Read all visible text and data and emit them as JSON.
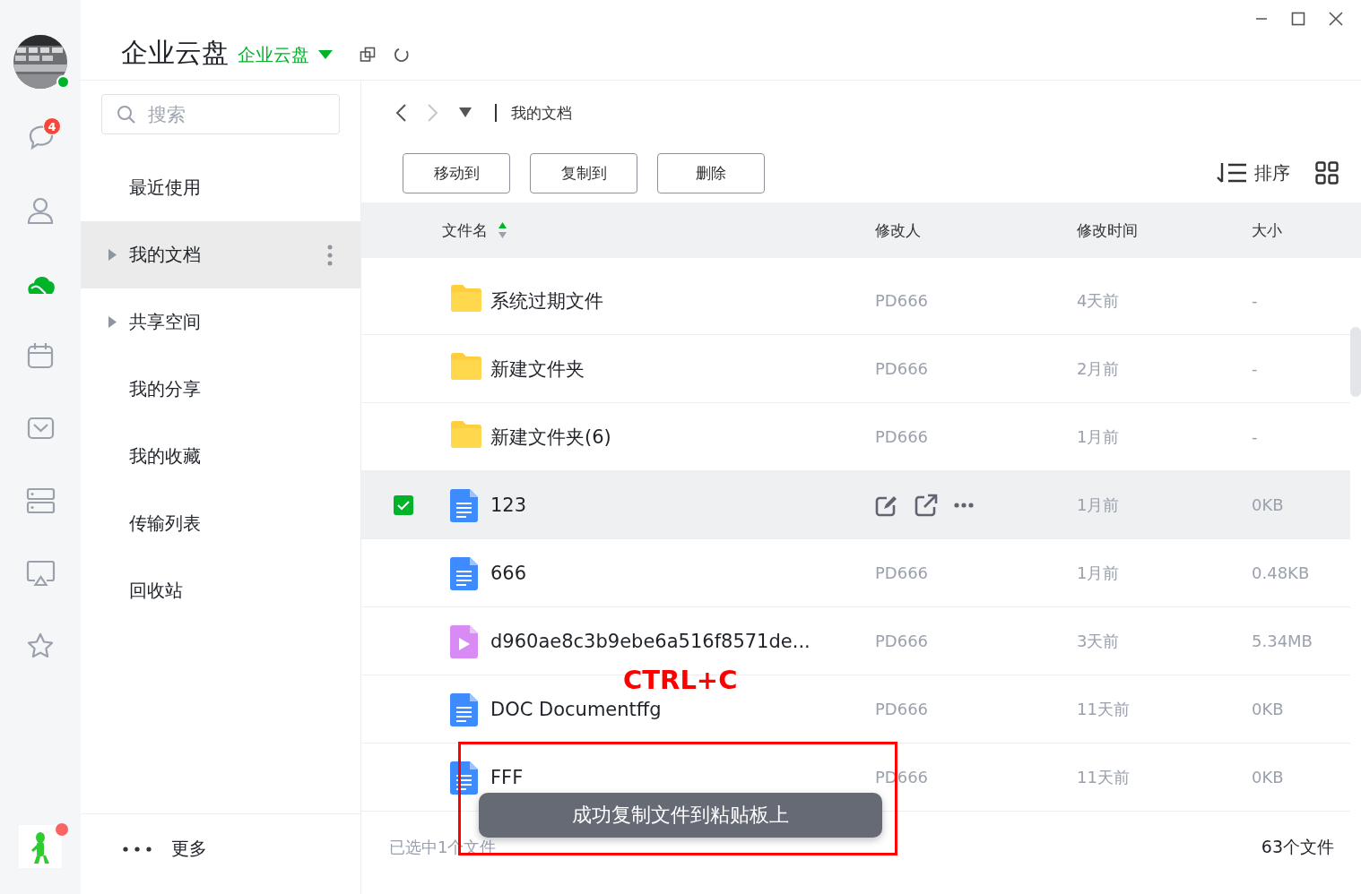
{
  "window": {
    "title": "企业云盘",
    "subtitle": "企业云盘"
  },
  "rail": {
    "avatar": {
      "kind": "picture",
      "online": true
    },
    "items": [
      {
        "kind": "chat",
        "selected": false,
        "badge": "4"
      },
      {
        "kind": "contacts",
        "selected": false
      },
      {
        "kind": "cloud",
        "selected": true
      },
      {
        "kind": "calendar",
        "selected": false
      },
      {
        "kind": "mail",
        "selected": false
      },
      {
        "kind": "storage",
        "selected": false
      },
      {
        "kind": "screen",
        "selected": false
      },
      {
        "kind": "star",
        "selected": false
      }
    ],
    "app_icon": {
      "kind": "picture",
      "unread": true
    }
  },
  "sidebar": {
    "search": {
      "placeholder": "搜索"
    },
    "items": [
      {
        "label": "最近使用",
        "kind": "page",
        "selected": false
      },
      {
        "label": "我的文档",
        "kind": "group",
        "selected": true
      },
      {
        "label": "共享空间",
        "kind": "group",
        "selected": false
      },
      {
        "label": "我的分享",
        "kind": "page",
        "selected": false
      },
      {
        "label": "我的收藏",
        "kind": "page",
        "selected": false
      },
      {
        "label": "传输列表",
        "kind": "page",
        "selected": false
      },
      {
        "label": "回收站",
        "kind": "page",
        "selected": false
      }
    ],
    "more": "更多"
  },
  "breadcrumb": {
    "path": "我的文档"
  },
  "toolbar": {
    "buttons": [
      "移动到",
      "复制到",
      "删除"
    ],
    "sort": "排序"
  },
  "table": {
    "columns": [
      {
        "label": "文件名",
        "ascending": true
      },
      {
        "label": "修改人"
      },
      {
        "label": "修改时间"
      },
      {
        "label": "大小"
      }
    ],
    "rows": [
      {
        "kind": "folder",
        "name": "系统过期文件",
        "modifier": "PD666",
        "time": "4天前",
        "size": "-",
        "selected": false
      },
      {
        "kind": "folder",
        "name": "新建文件夹",
        "modifier": "PD666",
        "time": "2月前",
        "size": "-",
        "selected": false
      },
      {
        "kind": "folder",
        "name": "新建文件夹(6)",
        "modifier": "PD666",
        "time": "1月前",
        "size": "-",
        "selected": false
      },
      {
        "kind": "doc",
        "name": "123",
        "time": "1月前",
        "size": "0KB",
        "selected": true
      },
      {
        "kind": "doc",
        "name": "666",
        "modifier": "PD666",
        "time": "1月前",
        "size": "0.48KB",
        "selected": false
      },
      {
        "kind": "video",
        "name": "d960ae8c3b9ebe6a516f8571de...",
        "modifier": "PD666",
        "time": "3天前",
        "size": "5.34MB",
        "selected": false
      },
      {
        "kind": "doc",
        "name": "DOC Documentffg",
        "modifier": "PD666",
        "time": "11天前",
        "size": "0KB",
        "selected": false
      },
      {
        "kind": "doc",
        "name": "FFF",
        "modifier": "PD666",
        "time": "11天前",
        "size": "0KB",
        "selected": false
      }
    ]
  },
  "status_bar": {
    "selection": "已选中1个文件",
    "total": "63个文件"
  },
  "toast": "成功复制文件到粘贴板上",
  "annotation": "CTRL+C"
}
